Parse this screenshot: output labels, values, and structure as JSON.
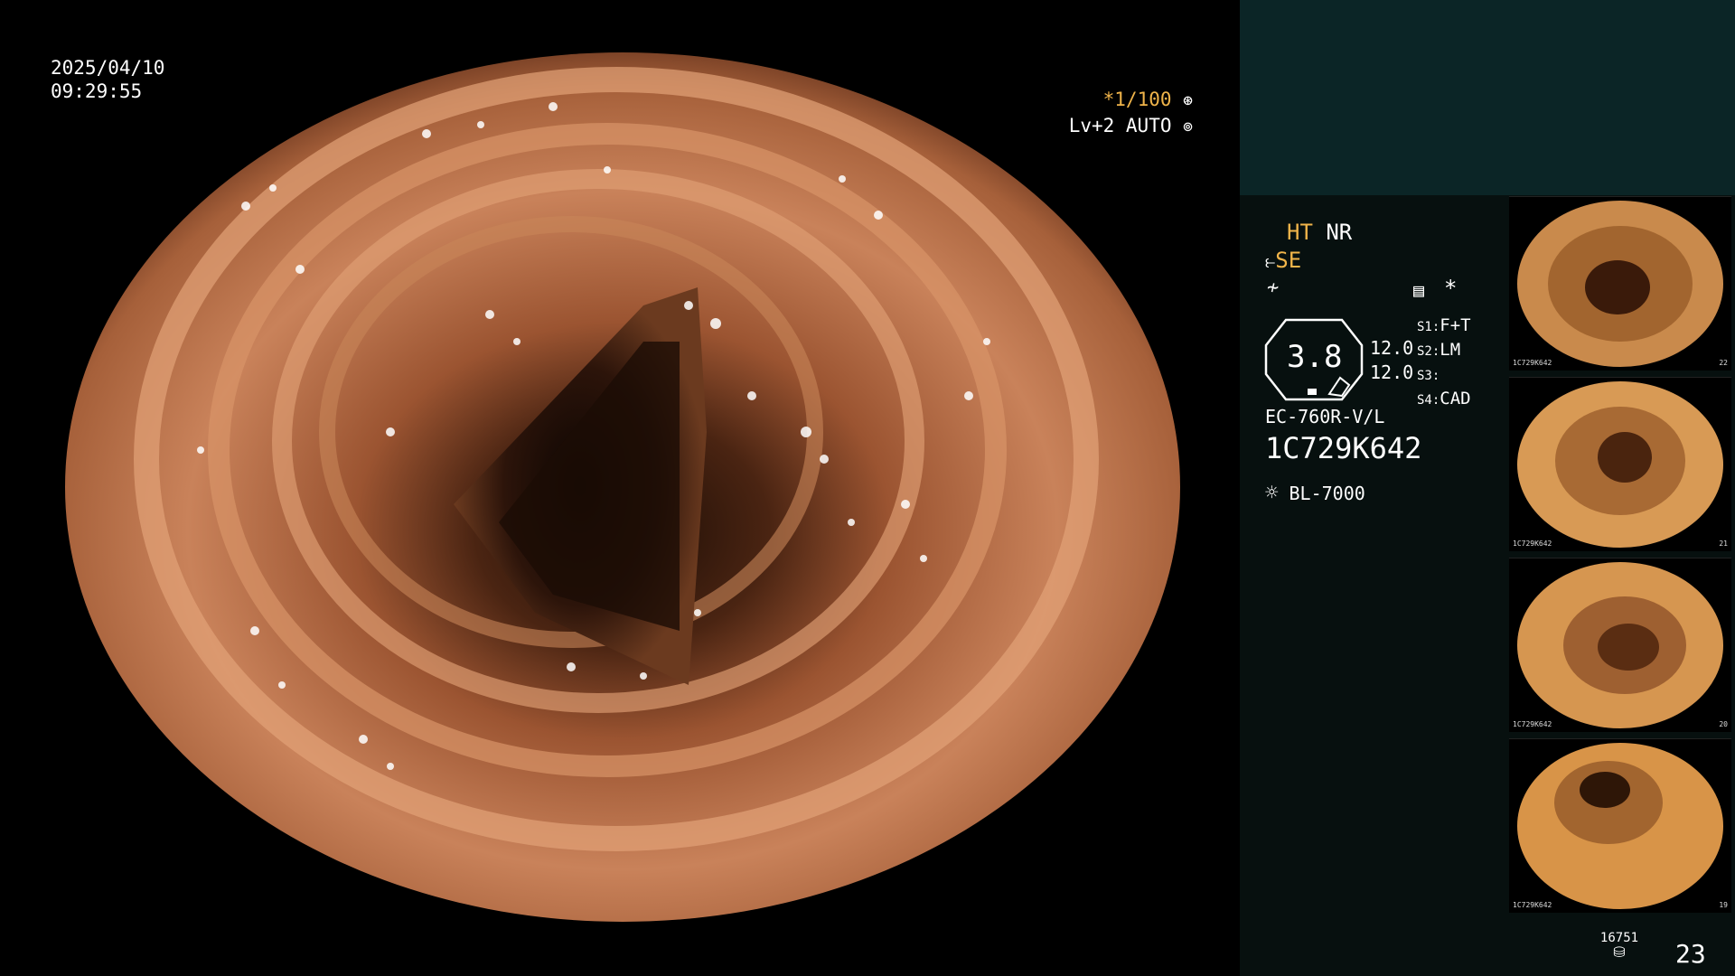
{
  "datetime": {
    "date": "2025/04/10",
    "time": "09:29:55"
  },
  "shutter": {
    "value": "*1/100",
    "icon": "aperture-icon"
  },
  "iris": {
    "value": "Lv+2 AUTO",
    "icon": "iris-icon"
  },
  "modes": {
    "ht": "HT",
    "nr": "NR",
    "se": "SE"
  },
  "structure": {
    "value": "3.8",
    "s1_label": "S1:",
    "s1_value": "F+T",
    "s2_label": "S2:",
    "s2_value": "LM",
    "s3_label": "S3:",
    "s3_value": "",
    "s4_label": "S4:",
    "s4_value": "CAD",
    "val_a": "12.0",
    "val_b": "12.0"
  },
  "scope": {
    "model": "EC-760R-V/L",
    "serial": "1C729K642"
  },
  "light": {
    "model": "BL-7000",
    "icon": "light-source-icon"
  },
  "thumbnails": [
    {
      "label": "1C729K642",
      "num": "22"
    },
    {
      "label": "1C729K642",
      "num": "21"
    },
    {
      "label": "1C729K642",
      "num": "20"
    },
    {
      "label": "1C729K642",
      "num": "19"
    }
  ],
  "storage": {
    "count": "16751",
    "icon": "storage-disk-icon",
    "frame": "23"
  },
  "colors": {
    "accent": "#f0b44a",
    "panel": "#0b2526",
    "panel_dark": "#07100f"
  }
}
